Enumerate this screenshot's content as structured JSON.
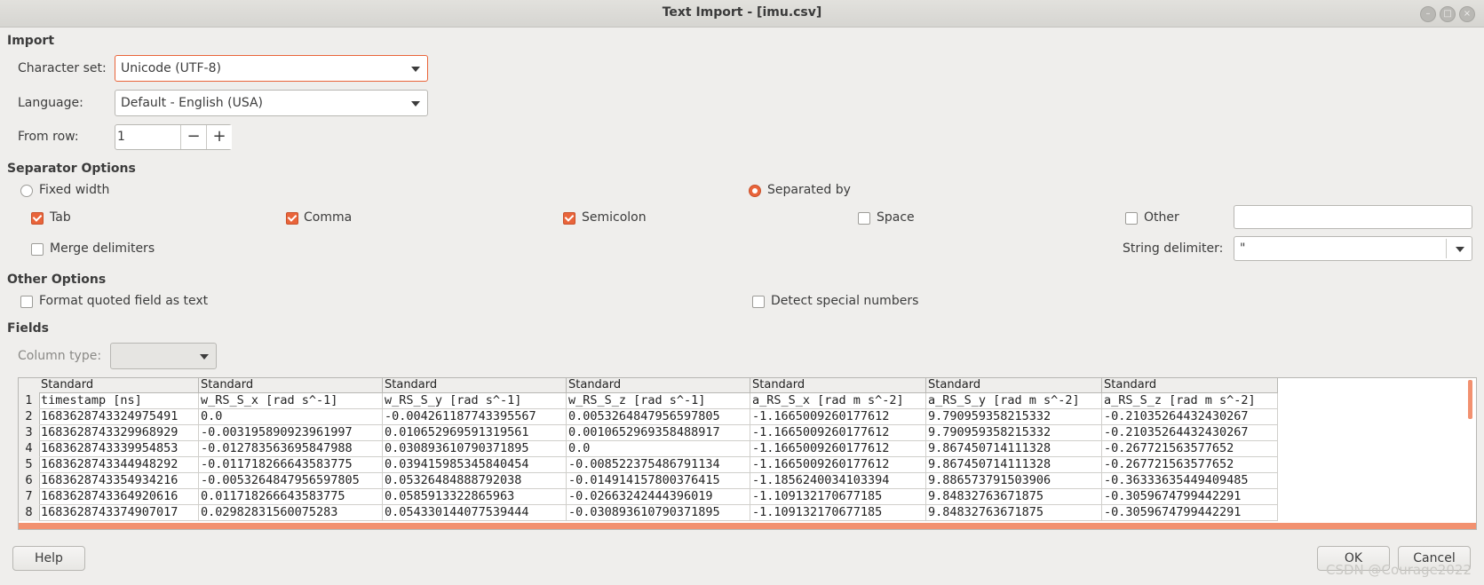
{
  "window": {
    "title": "Text Import - [imu.csv]",
    "btn_min": "–",
    "btn_max": "□",
    "btn_close": "×"
  },
  "import": {
    "section": "Import",
    "charset_label": "Character set:",
    "charset_value": "Unicode (UTF-8)",
    "language_label": "Language:",
    "language_value": "Default - English (USA)",
    "fromrow_label": "From row:",
    "fromrow_value": "1",
    "minus": "−",
    "plus": "+"
  },
  "separator": {
    "section": "Separator Options",
    "fixed_width": "Fixed width",
    "separated_by": "Separated by",
    "tab": "Tab",
    "comma": "Comma",
    "semicolon": "Semicolon",
    "space": "Space",
    "other": "Other",
    "merge": "Merge delimiters",
    "string_delim_label": "String delimiter:",
    "string_delim_value": "\""
  },
  "other_options": {
    "section": "Other Options",
    "format_quoted": "Format quoted field as text",
    "detect_special": "Detect special numbers"
  },
  "fields": {
    "section": "Fields",
    "column_type_label": "Column type:",
    "column_headers": [
      "Standard",
      "Standard",
      "Standard",
      "Standard",
      "Standard",
      "Standard",
      "Standard"
    ],
    "row_numbers": [
      "1",
      "2",
      "3",
      "4",
      "5",
      "6",
      "7",
      "8"
    ],
    "rows": [
      [
        "timestamp [ns]",
        "w_RS_S_x [rad s^-1]",
        "w_RS_S_y [rad s^-1]",
        "w_RS_S_z [rad s^-1]",
        "a_RS_S_x [rad m s^-2]",
        "a_RS_S_y [rad m s^-2]",
        "a_RS_S_z [rad m s^-2]"
      ],
      [
        "1683628743324975491",
        "0.0",
        "-0.004261187743395567",
        "0.005326484795659780​5",
        "-1.1665009260177612",
        "9.790959358215332",
        "-0.21035264432430267"
      ],
      [
        "1683628743329968929",
        "-0.003195890923961997",
        "0.010652969591319561",
        "0.0010652969358488917",
        "-1.1665009260177612",
        "9.790959358215332",
        "-0.21035264432430267"
      ],
      [
        "1683628743339954853",
        "-0.012783563695847988",
        "0.030893610790371895",
        "0.0",
        "-1.1665009260177612",
        "9.867450714111328",
        "-0.267721563577652"
      ],
      [
        "1683628743344948292",
        "-0.011718266643583775",
        "0.039415985345840454",
        "-0.008522375486791134",
        "-1.1665009260177612",
        "9.867450714111328",
        "-0.267721563577652"
      ],
      [
        "1683628743354934216",
        "-0.0053264847956597805",
        "0.05326484888792038",
        "-0.014914157800376415",
        "-1.1856240034103394",
        "9.886573791503906",
        "-0.36333635449409485"
      ],
      [
        "1683628743364920616",
        "0.011718266643583775",
        "0.0585913322865963",
        "-0.02663242444396019",
        "-1.109132170677185",
        "9.84832763671875",
        "-0.3059674799442291"
      ],
      [
        "1683628743374907017",
        "0.02982831560075283",
        "0.054330144077539444",
        "-0.030893610790371895",
        "-1.109132170677185",
        "9.84832763671875",
        "-0.3059674799442291"
      ]
    ]
  },
  "buttons": {
    "help": "Help",
    "ok": "OK",
    "cancel": "Cancel"
  },
  "watermark": "CSDN @Courage2022"
}
